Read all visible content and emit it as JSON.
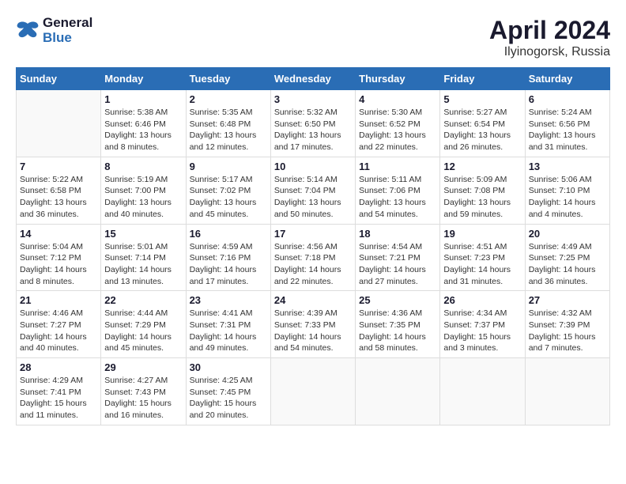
{
  "header": {
    "logo_line1": "General",
    "logo_line2": "Blue",
    "month_year": "April 2024",
    "location": "Ilyinogorsk, Russia"
  },
  "weekdays": [
    "Sunday",
    "Monday",
    "Tuesday",
    "Wednesday",
    "Thursday",
    "Friday",
    "Saturday"
  ],
  "weeks": [
    [
      {
        "day": "",
        "info": ""
      },
      {
        "day": "1",
        "info": "Sunrise: 5:38 AM\nSunset: 6:46 PM\nDaylight: 13 hours\nand 8 minutes."
      },
      {
        "day": "2",
        "info": "Sunrise: 5:35 AM\nSunset: 6:48 PM\nDaylight: 13 hours\nand 12 minutes."
      },
      {
        "day": "3",
        "info": "Sunrise: 5:32 AM\nSunset: 6:50 PM\nDaylight: 13 hours\nand 17 minutes."
      },
      {
        "day": "4",
        "info": "Sunrise: 5:30 AM\nSunset: 6:52 PM\nDaylight: 13 hours\nand 22 minutes."
      },
      {
        "day": "5",
        "info": "Sunrise: 5:27 AM\nSunset: 6:54 PM\nDaylight: 13 hours\nand 26 minutes."
      },
      {
        "day": "6",
        "info": "Sunrise: 5:24 AM\nSunset: 6:56 PM\nDaylight: 13 hours\nand 31 minutes."
      }
    ],
    [
      {
        "day": "7",
        "info": "Sunrise: 5:22 AM\nSunset: 6:58 PM\nDaylight: 13 hours\nand 36 minutes."
      },
      {
        "day": "8",
        "info": "Sunrise: 5:19 AM\nSunset: 7:00 PM\nDaylight: 13 hours\nand 40 minutes."
      },
      {
        "day": "9",
        "info": "Sunrise: 5:17 AM\nSunset: 7:02 PM\nDaylight: 13 hours\nand 45 minutes."
      },
      {
        "day": "10",
        "info": "Sunrise: 5:14 AM\nSunset: 7:04 PM\nDaylight: 13 hours\nand 50 minutes."
      },
      {
        "day": "11",
        "info": "Sunrise: 5:11 AM\nSunset: 7:06 PM\nDaylight: 13 hours\nand 54 minutes."
      },
      {
        "day": "12",
        "info": "Sunrise: 5:09 AM\nSunset: 7:08 PM\nDaylight: 13 hours\nand 59 minutes."
      },
      {
        "day": "13",
        "info": "Sunrise: 5:06 AM\nSunset: 7:10 PM\nDaylight: 14 hours\nand 4 minutes."
      }
    ],
    [
      {
        "day": "14",
        "info": "Sunrise: 5:04 AM\nSunset: 7:12 PM\nDaylight: 14 hours\nand 8 minutes."
      },
      {
        "day": "15",
        "info": "Sunrise: 5:01 AM\nSunset: 7:14 PM\nDaylight: 14 hours\nand 13 minutes."
      },
      {
        "day": "16",
        "info": "Sunrise: 4:59 AM\nSunset: 7:16 PM\nDaylight: 14 hours\nand 17 minutes."
      },
      {
        "day": "17",
        "info": "Sunrise: 4:56 AM\nSunset: 7:18 PM\nDaylight: 14 hours\nand 22 minutes."
      },
      {
        "day": "18",
        "info": "Sunrise: 4:54 AM\nSunset: 7:21 PM\nDaylight: 14 hours\nand 27 minutes."
      },
      {
        "day": "19",
        "info": "Sunrise: 4:51 AM\nSunset: 7:23 PM\nDaylight: 14 hours\nand 31 minutes."
      },
      {
        "day": "20",
        "info": "Sunrise: 4:49 AM\nSunset: 7:25 PM\nDaylight: 14 hours\nand 36 minutes."
      }
    ],
    [
      {
        "day": "21",
        "info": "Sunrise: 4:46 AM\nSunset: 7:27 PM\nDaylight: 14 hours\nand 40 minutes."
      },
      {
        "day": "22",
        "info": "Sunrise: 4:44 AM\nSunset: 7:29 PM\nDaylight: 14 hours\nand 45 minutes."
      },
      {
        "day": "23",
        "info": "Sunrise: 4:41 AM\nSunset: 7:31 PM\nDaylight: 14 hours\nand 49 minutes."
      },
      {
        "day": "24",
        "info": "Sunrise: 4:39 AM\nSunset: 7:33 PM\nDaylight: 14 hours\nand 54 minutes."
      },
      {
        "day": "25",
        "info": "Sunrise: 4:36 AM\nSunset: 7:35 PM\nDaylight: 14 hours\nand 58 minutes."
      },
      {
        "day": "26",
        "info": "Sunrise: 4:34 AM\nSunset: 7:37 PM\nDaylight: 15 hours\nand 3 minutes."
      },
      {
        "day": "27",
        "info": "Sunrise: 4:32 AM\nSunset: 7:39 PM\nDaylight: 15 hours\nand 7 minutes."
      }
    ],
    [
      {
        "day": "28",
        "info": "Sunrise: 4:29 AM\nSunset: 7:41 PM\nDaylight: 15 hours\nand 11 minutes."
      },
      {
        "day": "29",
        "info": "Sunrise: 4:27 AM\nSunset: 7:43 PM\nDaylight: 15 hours\nand 16 minutes."
      },
      {
        "day": "30",
        "info": "Sunrise: 4:25 AM\nSunset: 7:45 PM\nDaylight: 15 hours\nand 20 minutes."
      },
      {
        "day": "",
        "info": ""
      },
      {
        "day": "",
        "info": ""
      },
      {
        "day": "",
        "info": ""
      },
      {
        "day": "",
        "info": ""
      }
    ]
  ]
}
